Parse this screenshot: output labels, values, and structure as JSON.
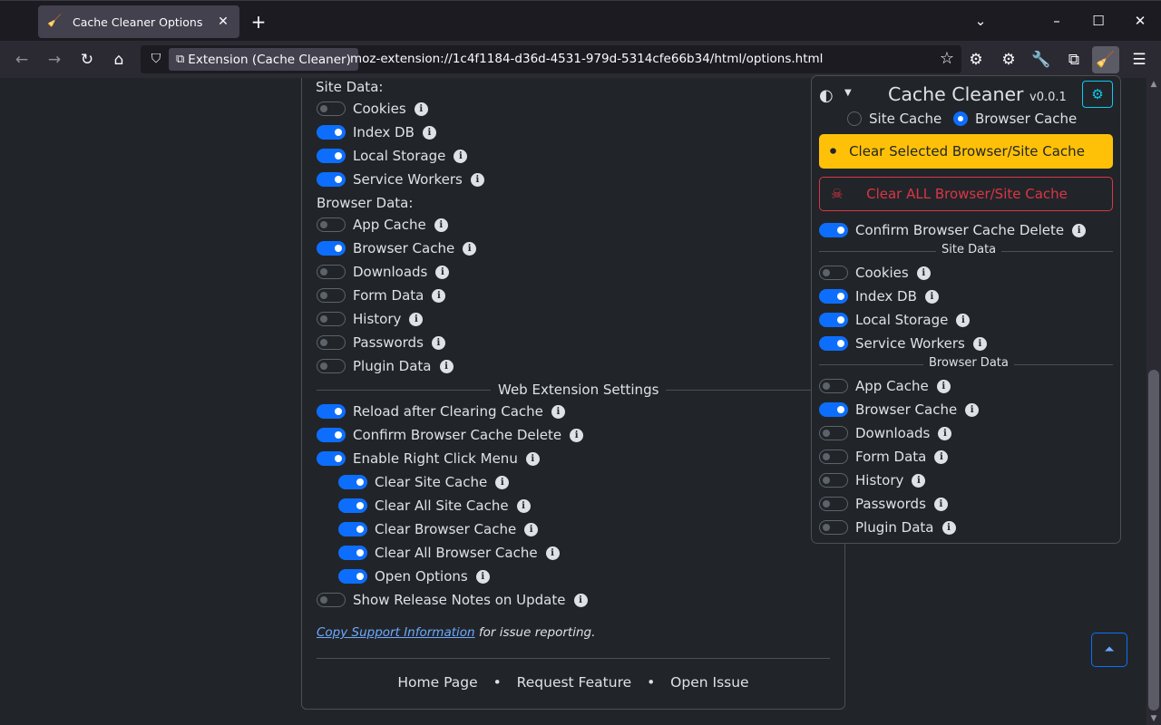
{
  "browser": {
    "tab_title": "Cache Cleaner Options",
    "tab_close": "✕",
    "new_tab": "+",
    "url_chip": "Extension (Cache Cleaner)",
    "url": "moz-extension://1c4f1184-d36d-4531-979d-5314cfe66b34/html/options.html"
  },
  "options": {
    "site_data_label": "Site Data:",
    "site_data": [
      {
        "label": "Cookies",
        "on": false
      },
      {
        "label": "Index DB",
        "on": true
      },
      {
        "label": "Local Storage",
        "on": true
      },
      {
        "label": "Service Workers",
        "on": true
      }
    ],
    "browser_data_label": "Browser Data:",
    "browser_data": [
      {
        "label": "App Cache",
        "on": false
      },
      {
        "label": "Browser Cache",
        "on": true
      },
      {
        "label": "Downloads",
        "on": false
      },
      {
        "label": "Form Data",
        "on": false
      },
      {
        "label": "History",
        "on": false
      },
      {
        "label": "Passwords",
        "on": false
      },
      {
        "label": "Plugin Data",
        "on": false
      }
    ],
    "web_ext_title": "Web Extension Settings",
    "web_ext": [
      {
        "label": "Reload after Clearing Cache",
        "on": true,
        "indent": false
      },
      {
        "label": "Confirm Browser Cache Delete",
        "on": true,
        "indent": false
      },
      {
        "label": "Enable Right Click Menu",
        "on": true,
        "indent": false
      },
      {
        "label": "Clear Site Cache",
        "on": true,
        "indent": true
      },
      {
        "label": "Clear All Site Cache",
        "on": true,
        "indent": true
      },
      {
        "label": "Clear Browser Cache",
        "on": true,
        "indent": true
      },
      {
        "label": "Clear All Browser Cache",
        "on": true,
        "indent": true
      },
      {
        "label": "Open Options",
        "on": true,
        "indent": true
      },
      {
        "label": "Show Release Notes on Update",
        "on": false,
        "indent": false
      }
    ],
    "support_link": "Copy Support Information",
    "support_suffix": " for issue reporting.",
    "footer": {
      "home": "Home Page",
      "request": "Request Feature",
      "issue": "Open Issue",
      "sep": "•"
    }
  },
  "popup": {
    "title": "Cache Cleaner",
    "version": "v0.0.1",
    "radio_site": "Site Cache",
    "radio_browser": "Browser Cache",
    "radio_selected": "browser",
    "btn_clear_selected": "Clear Selected Browser/Site Cache",
    "btn_clear_all": "Clear ALL Browser/Site Cache",
    "confirm": {
      "label": "Confirm Browser Cache Delete",
      "on": true
    },
    "site_data_title": "Site Data",
    "site_data": [
      {
        "label": "Cookies",
        "on": false
      },
      {
        "label": "Index DB",
        "on": true
      },
      {
        "label": "Local Storage",
        "on": true
      },
      {
        "label": "Service Workers",
        "on": true
      }
    ],
    "browser_data_title": "Browser Data",
    "browser_data": [
      {
        "label": "App Cache",
        "on": false
      },
      {
        "label": "Browser Cache",
        "on": true
      },
      {
        "label": "Downloads",
        "on": false
      },
      {
        "label": "Form Data",
        "on": false
      },
      {
        "label": "History",
        "on": false
      },
      {
        "label": "Passwords",
        "on": false
      },
      {
        "label": "Plugin Data",
        "on": false
      }
    ]
  },
  "colors": {
    "accent": "#0d6efd",
    "warning": "#ffc107",
    "danger": "#dc3545",
    "info": "#0dcaf0"
  }
}
